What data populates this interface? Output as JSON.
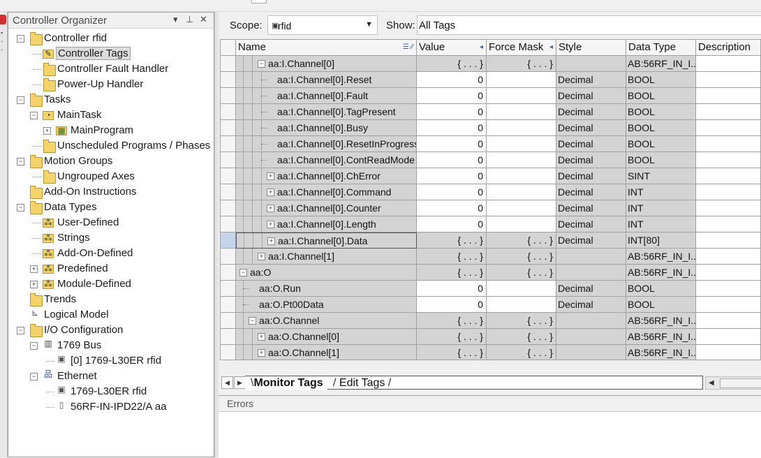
{
  "organizer": {
    "title": "Controller Organizer",
    "pin": "▾ ⭹",
    "close": "✕",
    "tree": [
      {
        "label": "Controller rfid",
        "depth": 0,
        "exp": "-",
        "icon": "folder"
      },
      {
        "label": "Controller Tags",
        "depth": 1,
        "icon": "tags",
        "selected": true
      },
      {
        "label": "Controller Fault Handler",
        "depth": 1,
        "icon": "folder"
      },
      {
        "label": "Power-Up Handler",
        "depth": 1,
        "icon": "folder"
      },
      {
        "label": "Tasks",
        "depth": 0,
        "exp": "-",
        "icon": "folder"
      },
      {
        "label": "MainTask",
        "depth": 1,
        "exp": "-",
        "icon": "task"
      },
      {
        "label": "MainProgram",
        "depth": 2,
        "exp": "+",
        "icon": "program"
      },
      {
        "label": "Unscheduled Programs / Phases",
        "depth": 1,
        "icon": "folder"
      },
      {
        "label": "Motion Groups",
        "depth": 0,
        "exp": "-",
        "icon": "folder"
      },
      {
        "label": "Ungrouped Axes",
        "depth": 1,
        "icon": "folder"
      },
      {
        "label": "Add-On Instructions",
        "depth": 0,
        "icon": "folder"
      },
      {
        "label": "Data Types",
        "depth": 0,
        "exp": "-",
        "icon": "folder"
      },
      {
        "label": "User-Defined",
        "depth": 1,
        "icon": "dtfolder"
      },
      {
        "label": "Strings",
        "depth": 1,
        "icon": "dtfolder"
      },
      {
        "label": "Add-On-Defined",
        "depth": 1,
        "icon": "dtfolder"
      },
      {
        "label": "Predefined",
        "depth": 1,
        "exp": "+",
        "icon": "dtfolder"
      },
      {
        "label": "Module-Defined",
        "depth": 1,
        "exp": "+",
        "icon": "dtfolder"
      },
      {
        "label": "Trends",
        "depth": 0,
        "icon": "folder"
      },
      {
        "label": "Logical Model",
        "depth": 0,
        "icon": "model"
      },
      {
        "label": "I/O Configuration",
        "depth": 0,
        "exp": "-",
        "icon": "folder"
      },
      {
        "label": "1769 Bus",
        "depth": 1,
        "exp": "-",
        "icon": "bus"
      },
      {
        "label": "[0] 1769-L30ER rfid",
        "depth": 2,
        "icon": "module"
      },
      {
        "label": "Ethernet",
        "depth": 1,
        "exp": "-",
        "icon": "ethernet"
      },
      {
        "label": "1769-L30ER rfid",
        "depth": 2,
        "icon": "module"
      },
      {
        "label": "56RF-IN-IPD22/A aa",
        "depth": 2,
        "icon": "device"
      }
    ]
  },
  "toolbar": {
    "scope_label": "Scope:",
    "scope_value": "rfid",
    "show_label": "Show:",
    "show_value": "All Tags"
  },
  "grid": {
    "columns": [
      "Name",
      "Value",
      "Force Mask",
      "Style",
      "Data Type",
      "Description"
    ],
    "rows": [
      {
        "name": "aa:I.Channel[0]",
        "indent": 2,
        "exp": "-",
        "value": "{...}",
        "force": "{...}",
        "style": "",
        "dtype": "AB:56RF_IN_I...",
        "gray": true
      },
      {
        "name": "aa:I.Channel[0].Reset",
        "indent": 3,
        "value": "0",
        "force": "",
        "style": "Decimal",
        "dtype": "BOOL"
      },
      {
        "name": "aa:I.Channel[0].Fault",
        "indent": 3,
        "value": "0",
        "force": "",
        "style": "Decimal",
        "dtype": "BOOL"
      },
      {
        "name": "aa:I.Channel[0].TagPresent",
        "indent": 3,
        "value": "0",
        "force": "",
        "style": "Decimal",
        "dtype": "BOOL"
      },
      {
        "name": "aa:I.Channel[0].Busy",
        "indent": 3,
        "value": "0",
        "force": "",
        "style": "Decimal",
        "dtype": "BOOL"
      },
      {
        "name": "aa:I.Channel[0].ResetInProgress",
        "indent": 3,
        "value": "0",
        "force": "",
        "style": "Decimal",
        "dtype": "BOOL"
      },
      {
        "name": "aa:I.Channel[0].ContReadMode",
        "indent": 3,
        "value": "0",
        "force": "",
        "style": "Decimal",
        "dtype": "BOOL"
      },
      {
        "name": "aa:I.Channel[0].ChError",
        "indent": 3,
        "exp": "+",
        "value": "0",
        "force": "",
        "style": "Decimal",
        "dtype": "SINT"
      },
      {
        "name": "aa:I.Channel[0].Command",
        "indent": 3,
        "exp": "+",
        "value": "0",
        "force": "",
        "style": "Decimal",
        "dtype": "INT"
      },
      {
        "name": "aa:I.Channel[0].Counter",
        "indent": 3,
        "exp": "+",
        "value": "0",
        "force": "",
        "style": "Decimal",
        "dtype": "INT"
      },
      {
        "name": "aa:I.Channel[0].Length",
        "indent": 3,
        "exp": "+",
        "value": "0",
        "force": "",
        "style": "Decimal",
        "dtype": "INT"
      },
      {
        "name": "aa:I.Channel[0].Data",
        "indent": 3,
        "exp": "+",
        "value": "{...}",
        "force": "{...}",
        "style": "Decimal",
        "dtype": "INT[80]",
        "current": true,
        "gray": true
      },
      {
        "name": "aa:I.Channel[1]",
        "indent": 2,
        "exp": "+",
        "value": "{...}",
        "force": "{...}",
        "style": "",
        "dtype": "AB:56RF_IN_I...",
        "gray": true
      },
      {
        "name": "aa:O",
        "indent": 0,
        "exp": "-",
        "value": "{...}",
        "force": "{...}",
        "style": "",
        "dtype": "AB:56RF_IN_I...",
        "gray": true
      },
      {
        "name": "aa:O.Run",
        "indent": 1,
        "value": "0",
        "force": "",
        "style": "Decimal",
        "dtype": "BOOL"
      },
      {
        "name": "aa:O.Pt00Data",
        "indent": 1,
        "value": "0",
        "force": "",
        "style": "Decimal",
        "dtype": "BOOL"
      },
      {
        "name": "aa:O.Channel",
        "indent": 1,
        "exp": "-",
        "value": "{...}",
        "force": "{...}",
        "style": "",
        "dtype": "AB:56RF_IN_I...",
        "gray": true
      },
      {
        "name": "aa:O.Channel[0]",
        "indent": 2,
        "exp": "+",
        "value": "{...}",
        "force": "{...}",
        "style": "",
        "dtype": "AB:56RF_IN_I...",
        "gray": true
      },
      {
        "name": "aa:O.Channel[1]",
        "indent": 2,
        "exp": "+",
        "value": "{...}",
        "force": "{...}",
        "style": "",
        "dtype": "AB:56RF_IN_I...",
        "gray": true
      }
    ]
  },
  "tabs": {
    "monitor": "Monitor Tags",
    "edit": "Edit Tags"
  },
  "errors": {
    "title": "Errors"
  },
  "colors": {
    "grid_gray": "#d4d4d4",
    "folder": "#f4d46a",
    "selection": "#c6d4ea"
  }
}
